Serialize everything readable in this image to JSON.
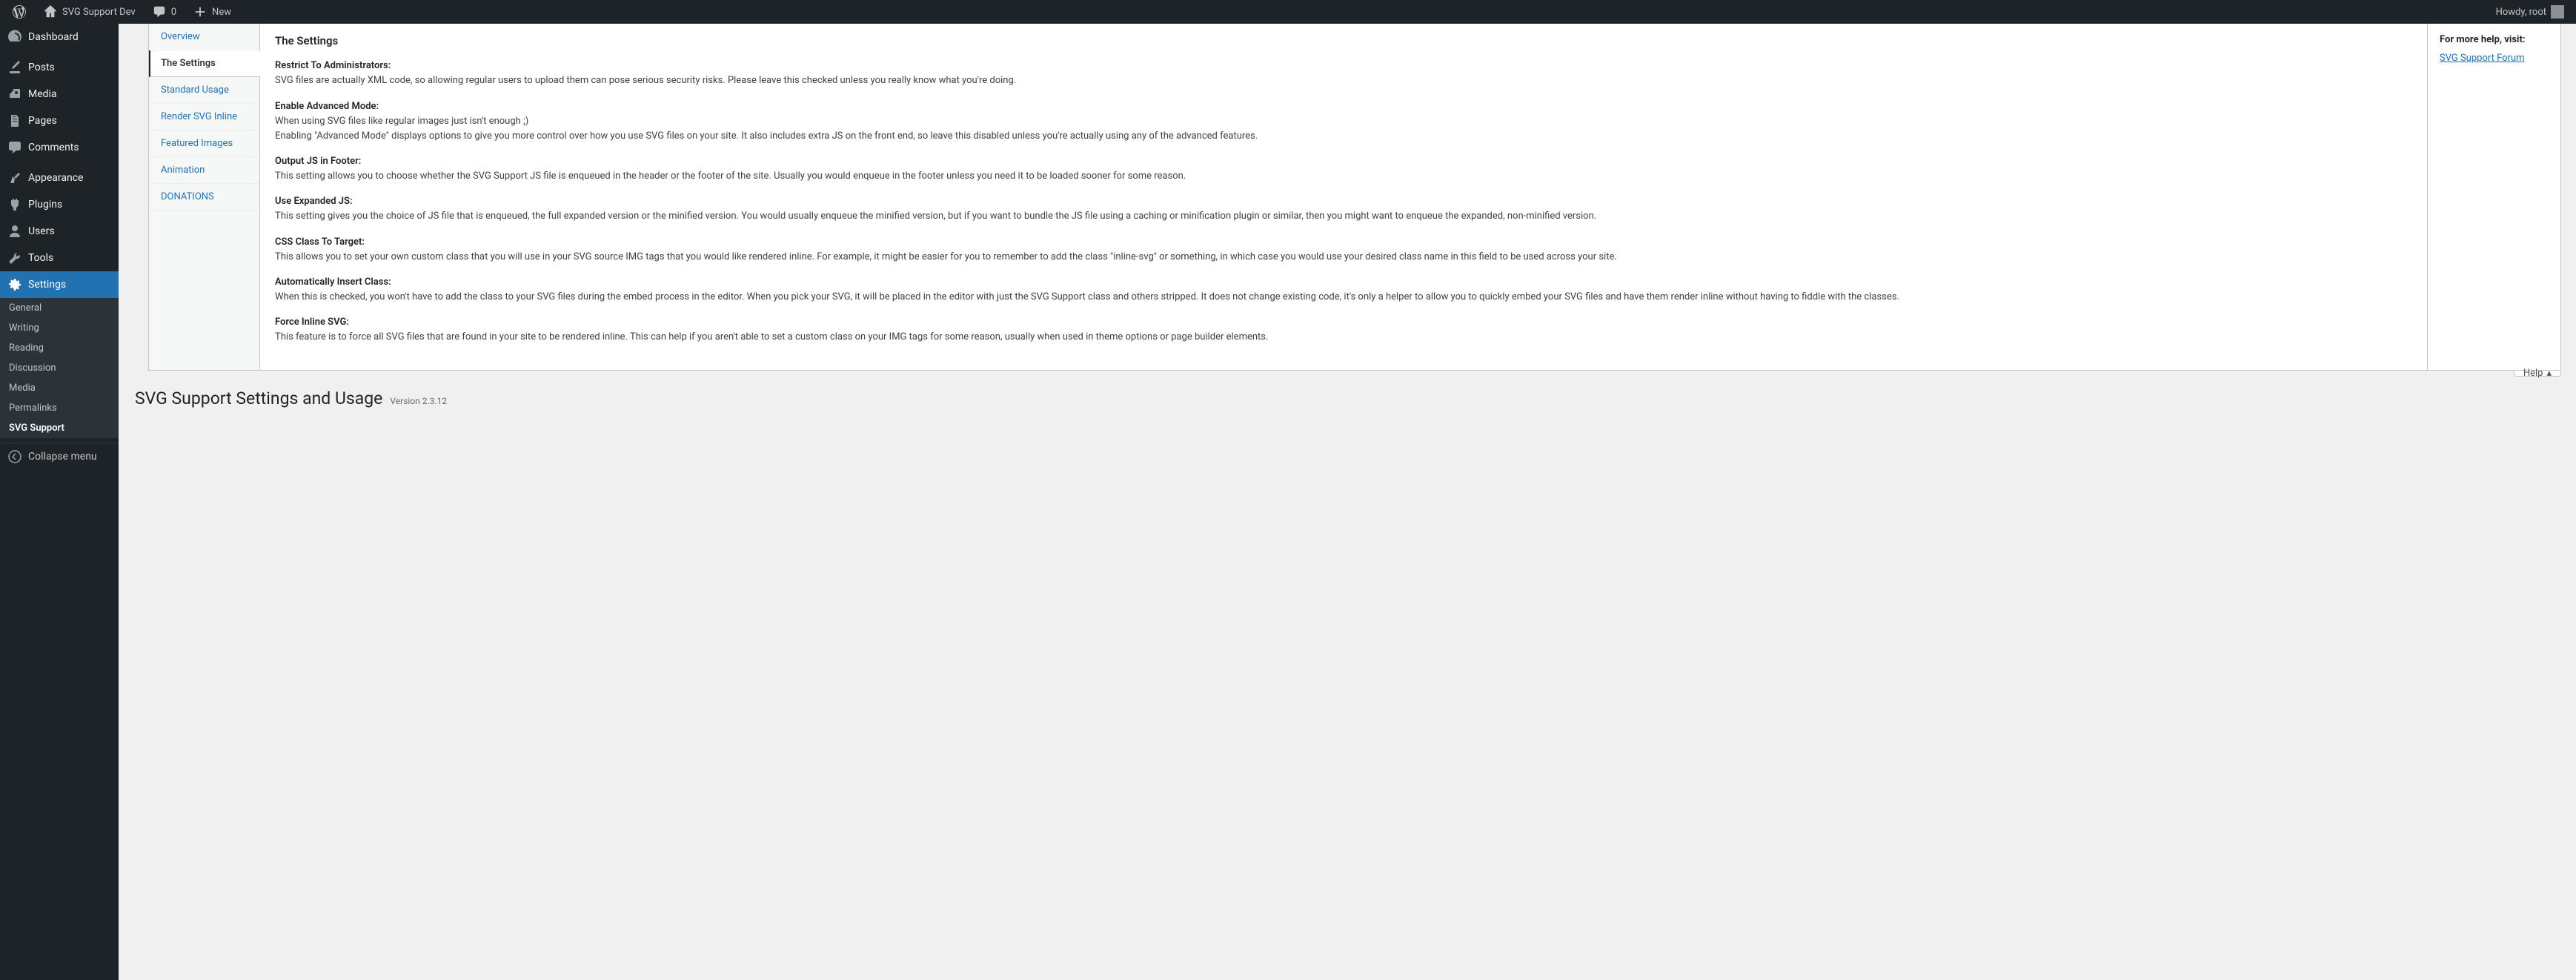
{
  "adminbar": {
    "site_name": "SVG Support Dev",
    "comments_count": "0",
    "new_label": "New",
    "howdy": "Howdy, root"
  },
  "sidebar": {
    "items": [
      {
        "label": "Dashboard",
        "icon": "dashboard"
      },
      {
        "label": "Posts",
        "icon": "posts"
      },
      {
        "label": "Media",
        "icon": "media"
      },
      {
        "label": "Pages",
        "icon": "pages"
      },
      {
        "label": "Comments",
        "icon": "comments"
      },
      {
        "label": "Appearance",
        "icon": "appearance"
      },
      {
        "label": "Plugins",
        "icon": "plugins"
      },
      {
        "label": "Users",
        "icon": "users"
      },
      {
        "label": "Tools",
        "icon": "tools"
      },
      {
        "label": "Settings",
        "icon": "settings"
      }
    ],
    "submenu": [
      {
        "label": "General"
      },
      {
        "label": "Writing"
      },
      {
        "label": "Reading"
      },
      {
        "label": "Discussion"
      },
      {
        "label": "Media"
      },
      {
        "label": "Permalinks"
      },
      {
        "label": "SVG Support"
      }
    ],
    "collapse_label": "Collapse menu"
  },
  "help": {
    "tabs": [
      {
        "label": "Overview"
      },
      {
        "label": "The Settings"
      },
      {
        "label": "Standard Usage"
      },
      {
        "label": "Render SVG Inline"
      },
      {
        "label": "Featured Images"
      },
      {
        "label": "Animation"
      },
      {
        "label": "DONATIONS"
      }
    ],
    "active_tab_index": 1,
    "content": {
      "title": "The Settings",
      "sections": [
        {
          "heading": "Restrict To Administrators:",
          "body": "SVG files are actually XML code, so allowing regular users to upload them can pose serious security risks. Please leave this checked unless you really know what you're doing."
        },
        {
          "heading": "Enable Advanced Mode:",
          "body": "When using SVG files like regular images just isn't enough ;)\nEnabling \"Advanced Mode\" displays options to give you more control over how you use SVG files on your site. It also includes extra JS on the front end, so leave this disabled unless you're actually using any of the advanced features."
        },
        {
          "heading": "Output JS in Footer:",
          "body": "This setting allows you to choose whether the SVG Support JS file is enqueued in the header or the footer of the site. Usually you would enqueue in the footer unless you need it to be loaded sooner for some reason."
        },
        {
          "heading": "Use Expanded JS:",
          "body": "This setting gives you the choice of JS file that is enqueued, the full expanded version or the minified version. You would usually enqueue the minified version, but if you want to bundle the JS file using a caching or minification plugin or similar, then you might want to enqueue the expanded, non-minified version."
        },
        {
          "heading": "CSS Class To Target:",
          "body": "This allows you to set your own custom class that you will use in your SVG source IMG tags that you would like rendered inline. For example, it might be easier for you to remember to add the class \"inline-svg\" or something, in which case you would use your desired class name in this field to be used across your site."
        },
        {
          "heading": "Automatically Insert Class:",
          "body": "When this is checked, you won't have to add the class to your SVG files during the embed process in the editor. When you pick your SVG, it will be placed in the editor with just the SVG Support class and others stripped. It does not change existing code, it's only a helper to allow you to quickly embed your SVG files and have them render inline without having to fiddle with the classes."
        },
        {
          "heading": "Force Inline SVG:",
          "body": "This feature is to force all SVG files that are found in your site to be rendered inline. This can help if you aren't able to set a custom class on your IMG tags for some reason, usually when used in theme options or page builder elements."
        }
      ]
    },
    "side": {
      "heading": "For more help, visit:",
      "link_label": "SVG Support Forum"
    },
    "toggle_label": "Help"
  },
  "page": {
    "title": "SVG Support Settings and Usage",
    "version": "Version 2.3.12"
  }
}
